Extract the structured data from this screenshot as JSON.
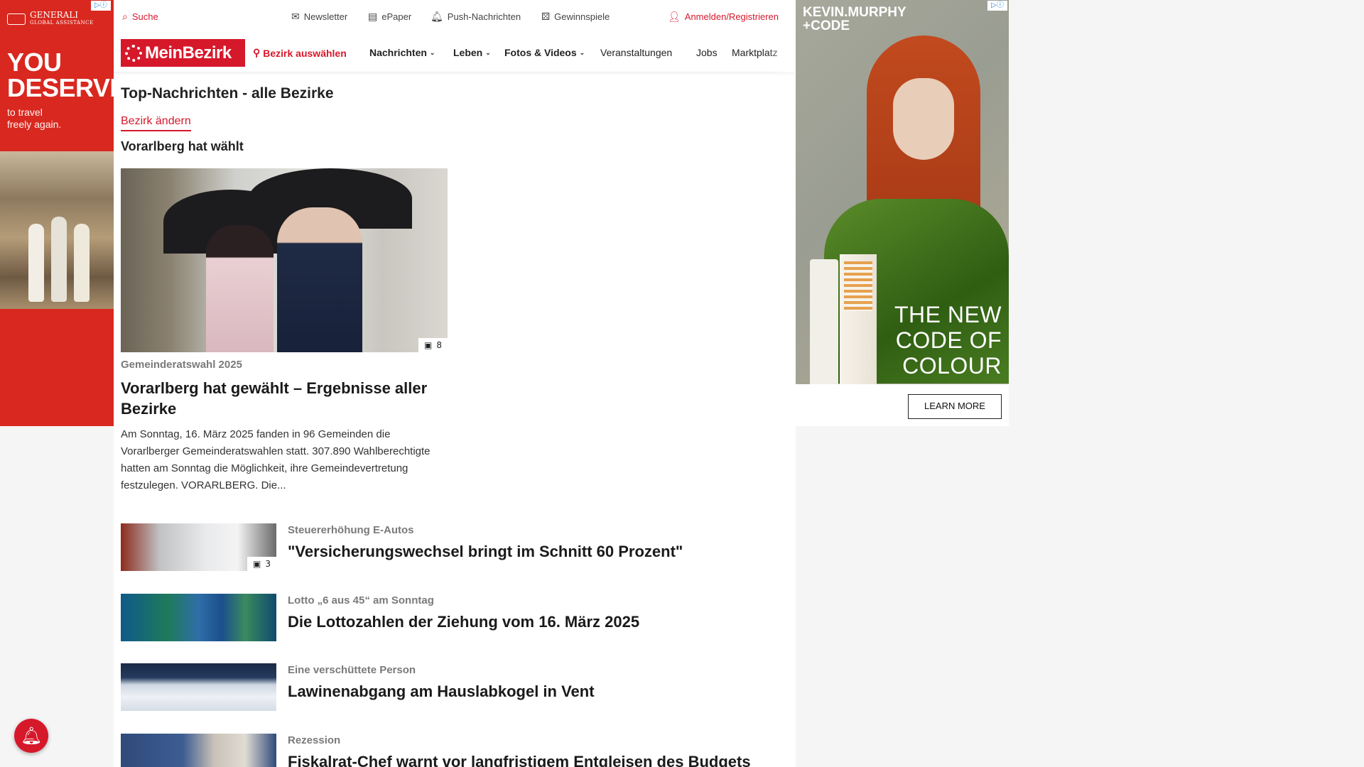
{
  "left_ad": {
    "brand_line1": "GENERALI",
    "brand_line2": "GLOBAL ASSISTANCE",
    "headline_1": "YOU",
    "headline_2": "DESERVE",
    "sub_1": "to travel",
    "sub_2": "freely again."
  },
  "topbar": {
    "search": "Suche",
    "newsletter": "Newsletter",
    "epaper": "ePaper",
    "push": "Push-Nachrichten",
    "gewinnspiele": "Gewinnspiele",
    "login": "Anmelden/Registrieren"
  },
  "nav": {
    "logo": "MeinBezirk",
    "bezirk": "Bezirk auswählen",
    "nachrichten": "Nachrichten",
    "leben": "Leben",
    "fotos": "Fotos & Videos",
    "veranstaltungen": "Veranstaltungen",
    "jobs": "Jobs",
    "marktplatz": "Marktplatz"
  },
  "page": {
    "title": "Top-Nachrichten - alle Bezirke",
    "change_link": "Bezirk ändern",
    "section_title": "Vorarlberg hat wählt"
  },
  "hero": {
    "image_count": "8",
    "kicker": "Gemeinderatswahl 2025",
    "title": "Vorarlberg hat gewählt – Ergebnisse aller Bezirke",
    "text": "Am Sonntag, 16. März 2025 fanden in 96 Gemeinden die Vorarlberger Gemeinderatswahlen statt. 307.890 Wahlberechtigte hatten am Sonntag die Möglichkeit, ihre Gemeindevertretung festzulegen. VORARLBERG. Die..."
  },
  "articles": [
    {
      "kicker": "Steuererhöhung E-Autos",
      "title": "\"Versicherungswechsel bringt im Schnitt 60 Prozent\"",
      "image_count": "3"
    },
    {
      "kicker": "Lotto „6 aus 45“ am Sonntag",
      "title": "Die Lottozahlen der Ziehung vom 16. März 2025"
    },
    {
      "kicker": "Eine verschüttete Person",
      "title": "Lawinenabgang am Hauslabkogel in Vent"
    },
    {
      "kicker": "Rezession",
      "title": "Fiskalrat-Chef warnt vor langfristigem Entgleisen des Budgets"
    }
  ],
  "right_ad": {
    "logo_1": "KEVIN.MURPHY",
    "logo_2": "+CODE",
    "tagline_1": "THE NEW",
    "tagline_2": "CODE OF",
    "tagline_3": "COLOUR",
    "cta": "LEARN MORE"
  },
  "colors": {
    "brand_red": "#d6182b"
  }
}
